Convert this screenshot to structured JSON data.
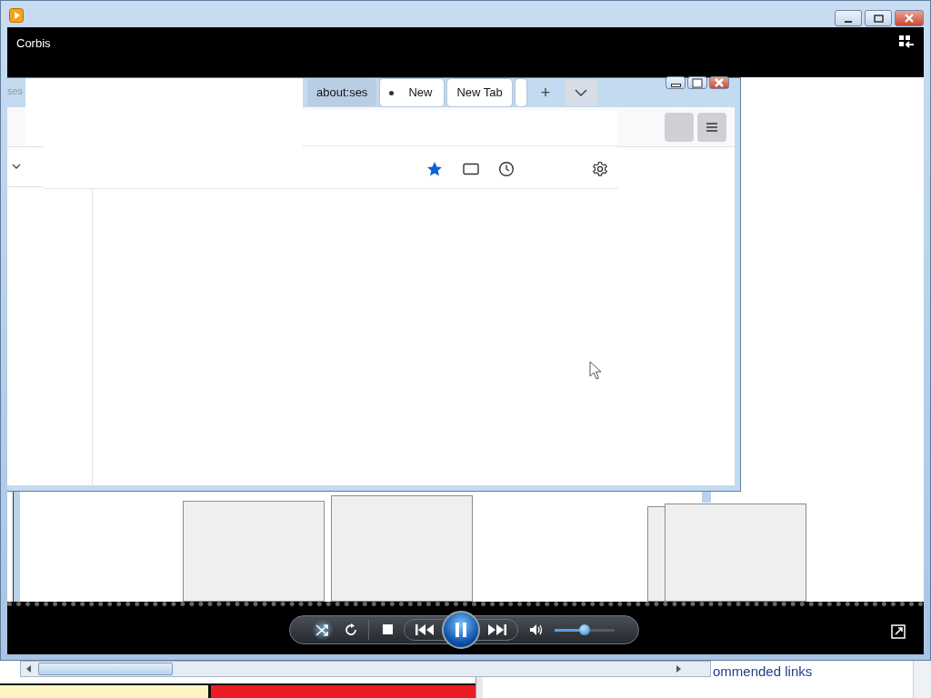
{
  "player": {
    "title": "Corbis"
  },
  "browser": {
    "clipped_tab": "ses",
    "tabs": [
      {
        "label": "about:ses",
        "dimmed": true,
        "bullet": false
      },
      {
        "label": "New",
        "dimmed": false,
        "bullet": true
      },
      {
        "label": "New Tab",
        "dimmed": false,
        "bullet": false
      }
    ],
    "new_tab": "+"
  },
  "controls": {
    "shuffle_on": true,
    "volume": {
      "level": 0.5
    }
  },
  "behind": {
    "heading": "ommended links"
  }
}
